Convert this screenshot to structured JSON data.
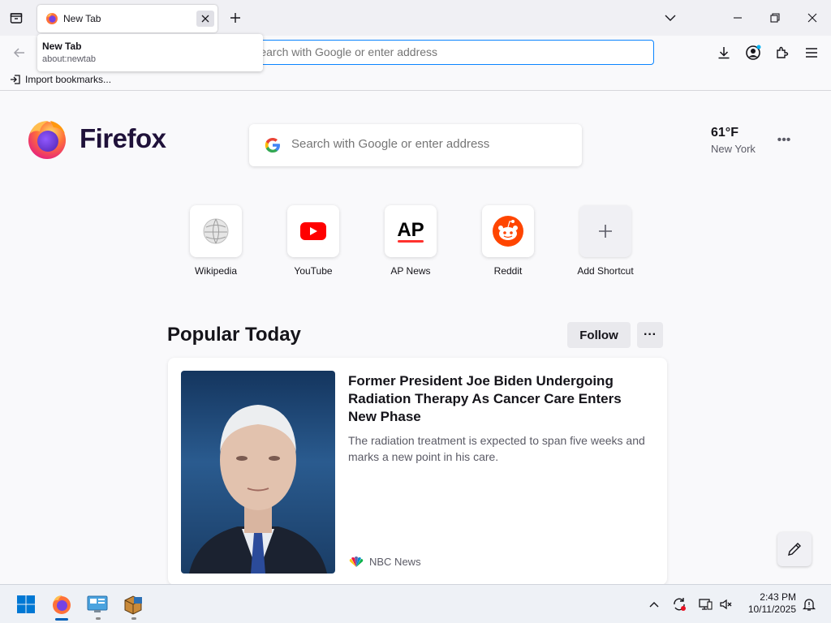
{
  "window": {
    "tab_title": "New Tab"
  },
  "tooltip": {
    "title": "New Tab",
    "url": "about:newtab"
  },
  "urlbar": {
    "placeholder": "Search with Google or enter address"
  },
  "bookmarks": {
    "import_label": "Import bookmarks..."
  },
  "newtab": {
    "brand": "Firefox",
    "search_placeholder": "Search with Google or enter address",
    "weather": {
      "temperature": "61°F",
      "city": "New York"
    },
    "shortcuts": [
      {
        "label": "Wikipedia"
      },
      {
        "label": "YouTube"
      },
      {
        "label": "AP News"
      },
      {
        "label": "Reddit"
      },
      {
        "label": "Add Shortcut"
      }
    ],
    "popular": {
      "title": "Popular Today",
      "follow_label": "Follow"
    },
    "story": {
      "headline": "Former President Joe Biden Undergoing Radiation Therapy As Cancer Care Enters New Phase",
      "description": "The radiation treatment is expected to span five weeks and marks a new point in his care.",
      "source": "NBC News"
    }
  },
  "taskbar": {
    "time": "2:43 PM",
    "date": "10/11/2025"
  },
  "colors": {
    "accent": "#0a84ff",
    "brand_dark": "#20123a"
  }
}
